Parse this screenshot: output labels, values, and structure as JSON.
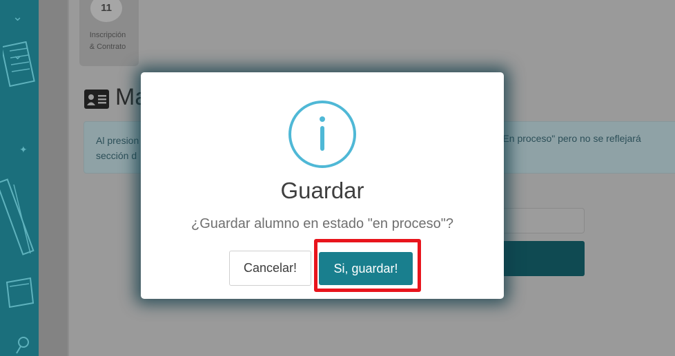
{
  "sidebar": {
    "icons": [
      "chevron-down-icon",
      "chevron-down-icon",
      "ruler-icon",
      "pencil-icon",
      "pushpin-icon"
    ]
  },
  "stepper": {
    "step_number": "11",
    "step_label_line1": "Inscripción",
    "step_label_line2": "& Contrato"
  },
  "section": {
    "title_visible": "Ma",
    "icon": "id-card-icon"
  },
  "info_box": {
    "line1_left": "Al presion",
    "line1_right": "do \"En proceso\" pero no se reflejará",
    "line2_left": "sección d"
  },
  "modal": {
    "icon": "info-icon",
    "title": "Guardar",
    "message": "¿Guardar alumno en estado \"en proceso\"?",
    "cancel_label": "Cancelar!",
    "confirm_label": "Si, guardar!"
  },
  "colors": {
    "accent": "#197f8e",
    "info_icon": "#4fb8d6",
    "highlight": "#e8141c",
    "sidebar": "#1b6f7c"
  }
}
